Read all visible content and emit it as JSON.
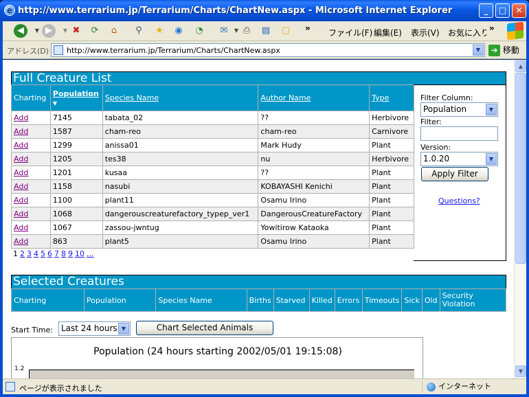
{
  "window": {
    "title": "http://www.terrarium.jp/Terrarium/Charts/ChartNew.aspx - Microsoft Internet Explorer",
    "minimize": "_",
    "maximize": "□",
    "close": "✕"
  },
  "toolbar": {
    "menus": [
      "ファイル(F)",
      "編集(E)",
      "表示(V)",
      "お気に入り"
    ],
    "overflow": "»"
  },
  "address": {
    "label": "アドレス(D)",
    "url": "http://www.terrarium.jp/Terrarium/Charts/ChartNew.aspx",
    "go_label": "移動"
  },
  "full_list": {
    "title": "Full Creature List",
    "columns": [
      "Charting",
      "Population",
      "Species Name",
      "Author Name",
      "Type"
    ],
    "sort_indicator": "▼",
    "rows": [
      {
        "action": "Add",
        "population": "7145",
        "species": "tabata_02",
        "author": "??",
        "type": "Herbivore"
      },
      {
        "action": "Add",
        "population": "1587",
        "species": "cham-reo",
        "author": "cham-reo",
        "type": "Carnivore"
      },
      {
        "action": "Add",
        "population": "1299",
        "species": "anissa01",
        "author": "Mark Hudy",
        "type": "Plant"
      },
      {
        "action": "Add",
        "population": "1205",
        "species": "tes38",
        "author": "nu",
        "type": "Herbivore"
      },
      {
        "action": "Add",
        "population": "1201",
        "species": "kusaa",
        "author": "??",
        "type": "Plant"
      },
      {
        "action": "Add",
        "population": "1158",
        "species": "nasubi",
        "author": "KOBAYASHI Kenichi",
        "type": "Plant"
      },
      {
        "action": "Add",
        "population": "1100",
        "species": "plant11",
        "author": "Osamu Irino",
        "type": "Plant"
      },
      {
        "action": "Add",
        "population": "1068",
        "species": "dangerouscreaturefactory_typep_ver1",
        "author": "DangerousCreatureFactory",
        "type": "Plant"
      },
      {
        "action": "Add",
        "population": "1067",
        "species": "zassou-jwntug",
        "author": "Yowitirow Kataoka",
        "type": "Plant"
      },
      {
        "action": "Add",
        "population": "863",
        "species": "plant5",
        "author": "Osamu Irino",
        "type": "Plant"
      }
    ],
    "pager": [
      "1",
      "2",
      "3",
      "4",
      "5",
      "6",
      "7",
      "8",
      "9",
      "10",
      "..."
    ]
  },
  "filter": {
    "column_label": "Filter Column:",
    "column_value": "Population",
    "filter_label": "Filter:",
    "filter_value": "",
    "version_label": "Version:",
    "version_value": "1.0.20",
    "apply_label": "Apply Filter",
    "questions_label": "Questions?"
  },
  "selected": {
    "title": "Selected Creatures",
    "columns": [
      "Charting",
      "Population",
      "Species Name",
      "Births",
      "Starved",
      "Killed",
      "Errors",
      "Timeouts",
      "Sick",
      "Old",
      "Security Violation"
    ]
  },
  "chart_controls": {
    "start_time_label": "Start Time:",
    "start_time_value": "Last 24 hours",
    "chart_button": "Chart Selected Animals"
  },
  "chart": {
    "title": "Population (24 hours starting 2002/05/01 19:15:08)",
    "first_tick": "1.2"
  },
  "status": {
    "text": "ページが表示されました",
    "zone": "インターネット"
  }
}
